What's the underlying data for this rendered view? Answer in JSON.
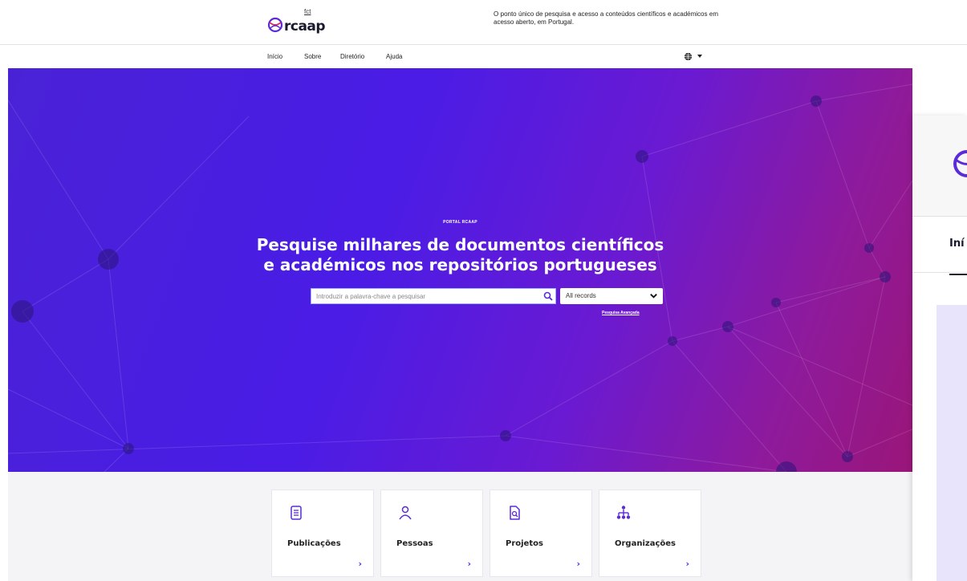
{
  "header": {
    "logo_text": "rcaap",
    "logo_fct": "fct",
    "tagline": "O ponto único de pesquisa e acesso a conteúdos científicos e académicos em acesso aberto, em Portugal."
  },
  "nav": {
    "items": [
      "Início",
      "Sobre",
      "Diretório",
      "Ajuda"
    ],
    "language_icon": "globe-icon"
  },
  "hero": {
    "kicker": "PORTAL RCAAP",
    "title_line1": "Pesquise milhares de documentos científicos",
    "title_line2": "e académicos nos repositórios portugueses",
    "search_placeholder": "Introduzir a palavra-chave a pesquisar",
    "select_value": "All records",
    "advanced_link": "Pesquisa Avançada"
  },
  "cards": [
    {
      "label": "Publicações",
      "icon": "document-icon",
      "arrow": "›"
    },
    {
      "label": "Pessoas",
      "icon": "person-icon",
      "arrow": "›"
    },
    {
      "label": "Projetos",
      "icon": "file-search-icon",
      "arrow": "›"
    },
    {
      "label": "Organizações",
      "icon": "org-chart-icon",
      "arrow": "›"
    }
  ],
  "side_panel": {
    "nav_partial": "Iní"
  },
  "colors": {
    "accent": "#5a2bd6",
    "hero_start": "#4a22d6",
    "hero_end": "#9a1679",
    "band_bg": "#f4f4f6"
  }
}
